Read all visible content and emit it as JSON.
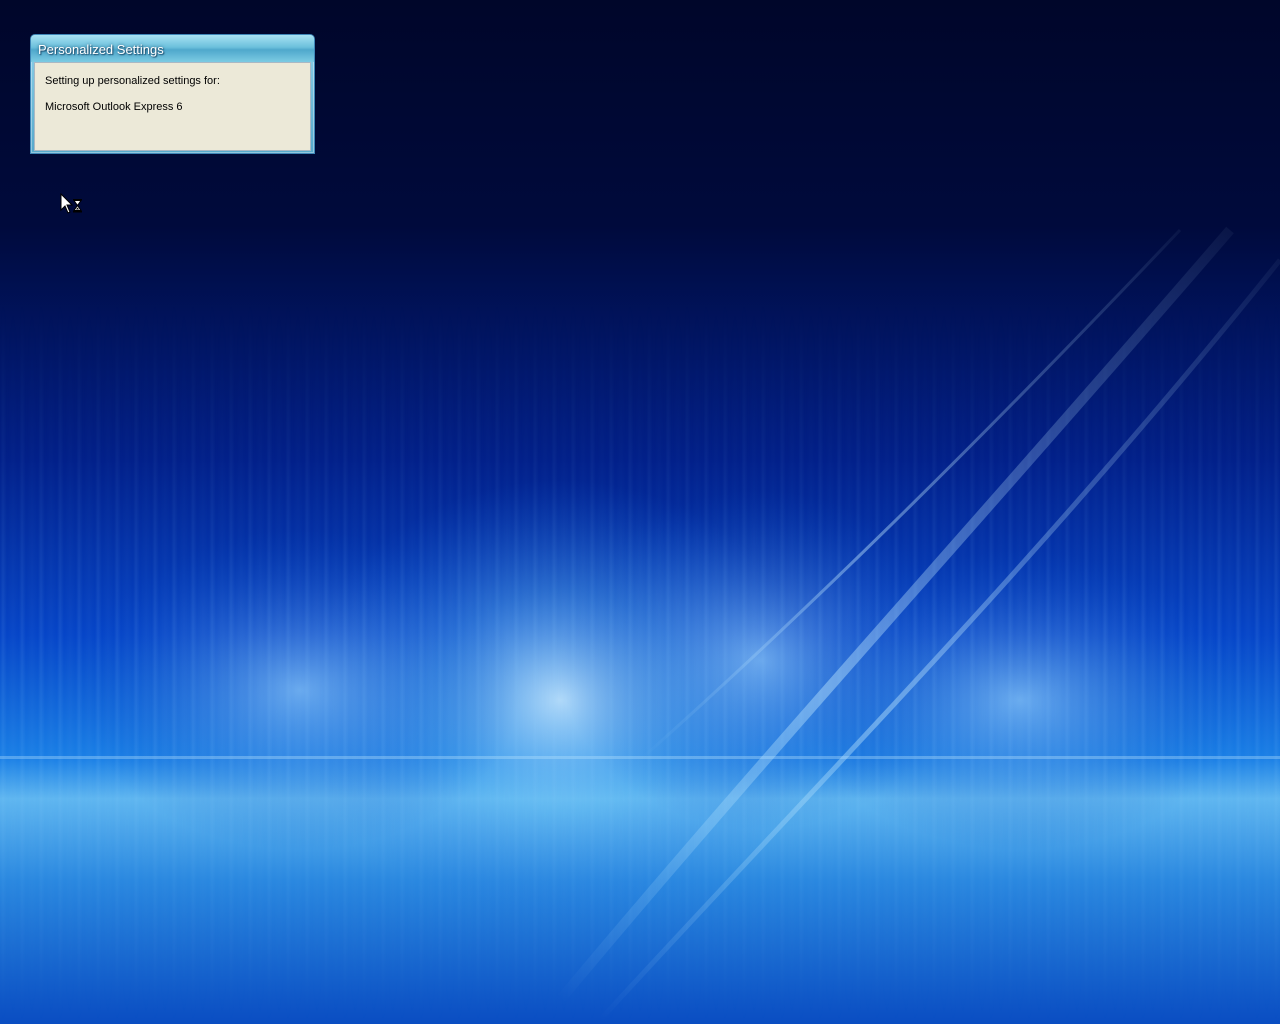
{
  "dialog": {
    "title": "Personalized Settings",
    "line1": "Setting up personalized settings for:",
    "line2": "Microsoft Outlook Express 6"
  },
  "cursor": {
    "icon": "busy-arrow-icon"
  },
  "colors": {
    "desktop_dark": "#00062a",
    "desktop_glow": "#5fb6f0",
    "dialog_face": "#ece9d8",
    "titlebar": "#6cc0dc"
  }
}
